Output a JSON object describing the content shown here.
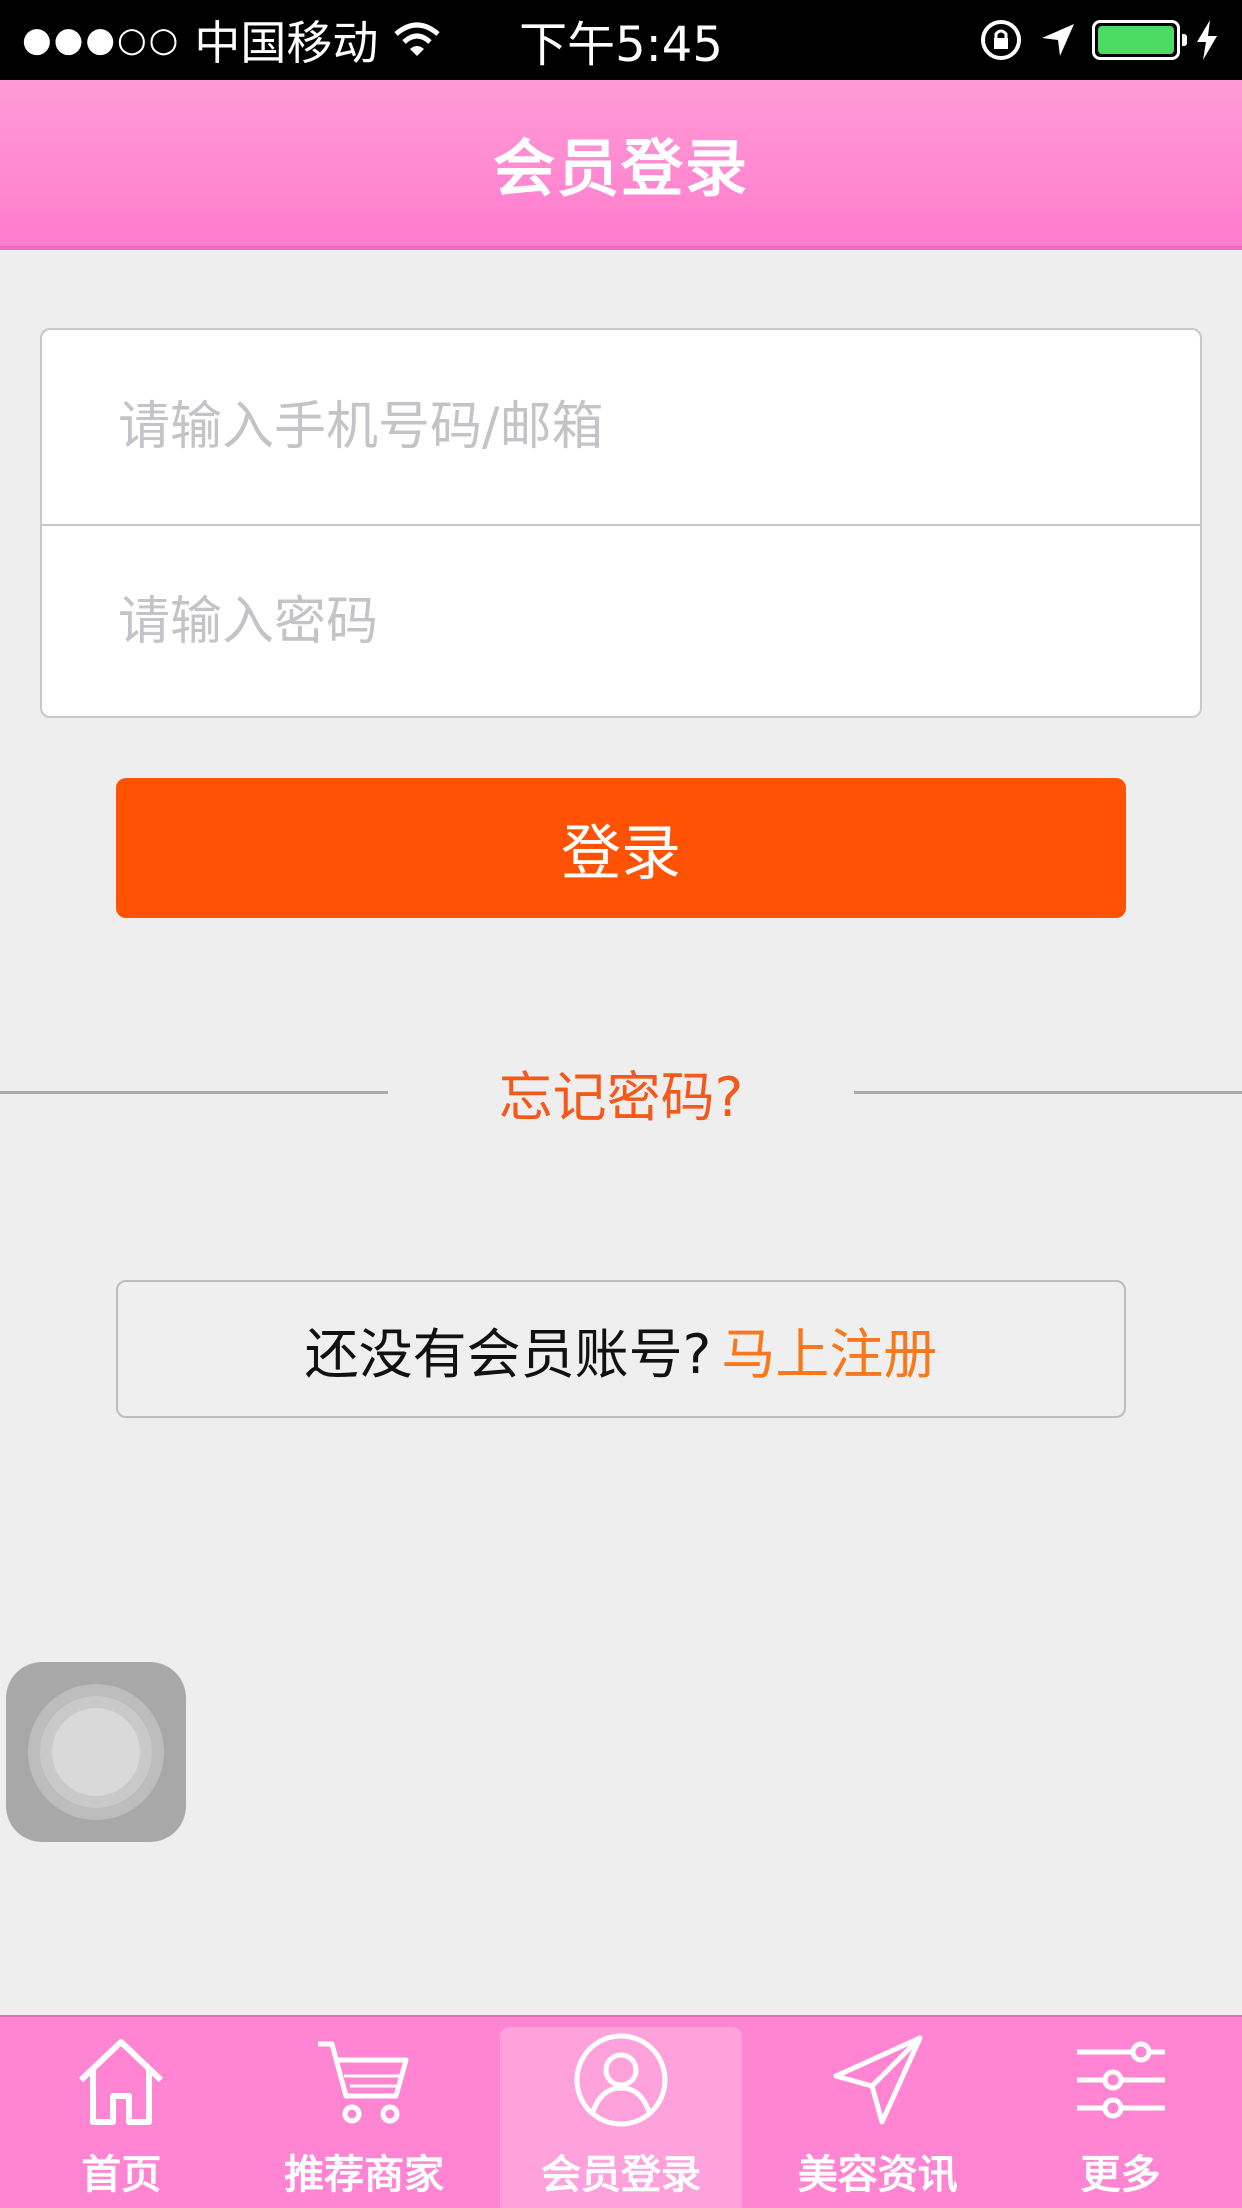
{
  "status_bar": {
    "signal": "●●●○○",
    "carrier": "中国移动",
    "time": "下午5:45"
  },
  "header": {
    "title": "会员登录"
  },
  "login_form": {
    "account_placeholder": "请输入手机号码/邮箱",
    "password_placeholder": "请输入密码",
    "submit_label": "登录"
  },
  "forgot_password": "忘记密码?",
  "register": {
    "prompt": "还没有会员账号?",
    "link": "马上注册"
  },
  "tabs": [
    {
      "label": "首页",
      "icon": "home-icon"
    },
    {
      "label": "推荐商家",
      "icon": "cart-icon"
    },
    {
      "label": "会员登录",
      "icon": "user-icon",
      "active": true
    },
    {
      "label": "美容资讯",
      "icon": "send-icon"
    },
    {
      "label": "更多",
      "icon": "sliders-icon"
    }
  ],
  "colors": {
    "header": "#ff85d3",
    "login_button": "#ff5204",
    "forgot_link": "#f2591b",
    "register_link": "#f9781e",
    "battery": "#4cd964"
  }
}
